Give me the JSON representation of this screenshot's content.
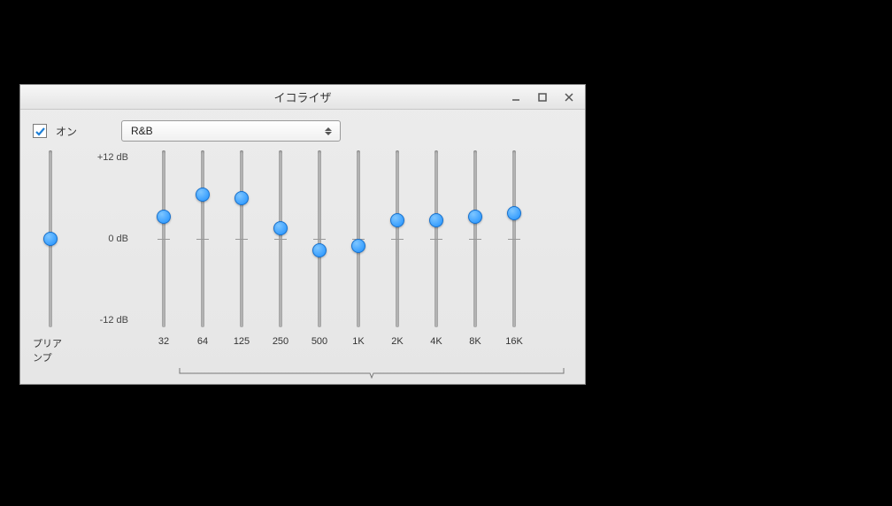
{
  "window": {
    "title": "イコライザ"
  },
  "on_checkbox": {
    "label": "オン",
    "checked": true
  },
  "preset": {
    "selected": "R&B"
  },
  "scale": {
    "top": "+12 dB",
    "mid": "0 dB",
    "bottom": "-12 dB"
  },
  "preamp": {
    "label": "プリアンプ",
    "value_db": 0
  },
  "bands": [
    {
      "freq": "32",
      "value_db": 3.0
    },
    {
      "freq": "64",
      "value_db": 6.0
    },
    {
      "freq": "125",
      "value_db": 5.5
    },
    {
      "freq": "250",
      "value_db": 1.5
    },
    {
      "freq": "500",
      "value_db": -1.5
    },
    {
      "freq": "1K",
      "value_db": -1.0
    },
    {
      "freq": "2K",
      "value_db": 2.5
    },
    {
      "freq": "4K",
      "value_db": 2.5
    },
    {
      "freq": "8K",
      "value_db": 3.0
    },
    {
      "freq": "16K",
      "value_db": 3.5
    }
  ]
}
